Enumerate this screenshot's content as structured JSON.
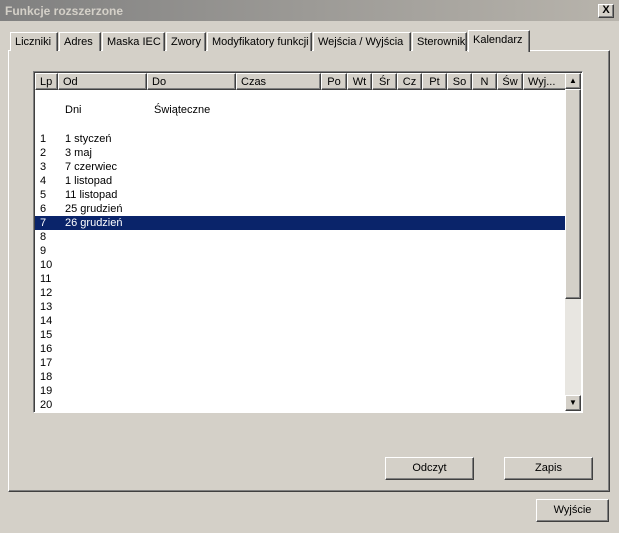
{
  "window": {
    "title": "Funkcje rozszerzone",
    "close_label": "X"
  },
  "tabs": [
    {
      "label": "Liczniki"
    },
    {
      "label": "Adres"
    },
    {
      "label": "Maska IEC"
    },
    {
      "label": "Zwory"
    },
    {
      "label": "Modyfikatory funkcji"
    },
    {
      "label": "Wejścia / Wyjścia"
    },
    {
      "label": "Sterownik"
    },
    {
      "label": "Kalendarz"
    }
  ],
  "active_tab": "Kalendarz",
  "list": {
    "columns": [
      "Lp",
      "Od",
      "Do",
      "Czas",
      "Po",
      "Wt",
      "Śr",
      "Cz",
      "Pt",
      "So",
      "N",
      "Św",
      "Wyj..."
    ],
    "section": {
      "od_label": "Dni",
      "do_label": "Świąteczne"
    },
    "rows": [
      {
        "lp": "1",
        "od": "1 styczeń"
      },
      {
        "lp": "2",
        "od": "3 maj"
      },
      {
        "lp": "3",
        "od": "7 czerwiec"
      },
      {
        "lp": "4",
        "od": "1 listopad"
      },
      {
        "lp": "5",
        "od": "11 listopad"
      },
      {
        "lp": "6",
        "od": "25 grudzień"
      },
      {
        "lp": "7",
        "od": "26 grudzień"
      },
      {
        "lp": "8",
        "od": ""
      },
      {
        "lp": "9",
        "od": ""
      },
      {
        "lp": "10",
        "od": ""
      },
      {
        "lp": "11",
        "od": ""
      },
      {
        "lp": "12",
        "od": ""
      },
      {
        "lp": "13",
        "od": ""
      },
      {
        "lp": "14",
        "od": ""
      },
      {
        "lp": "15",
        "od": ""
      },
      {
        "lp": "16",
        "od": ""
      },
      {
        "lp": "17",
        "od": ""
      },
      {
        "lp": "18",
        "od": ""
      },
      {
        "lp": "19",
        "od": ""
      },
      {
        "lp": "20",
        "od": ""
      }
    ],
    "selected_row": "7"
  },
  "buttons": {
    "read": "Odczyt",
    "write": "Zapis",
    "exit": "Wyjście"
  },
  "colors": {
    "selection": "#0a246a",
    "face": "#d4d0c8"
  }
}
